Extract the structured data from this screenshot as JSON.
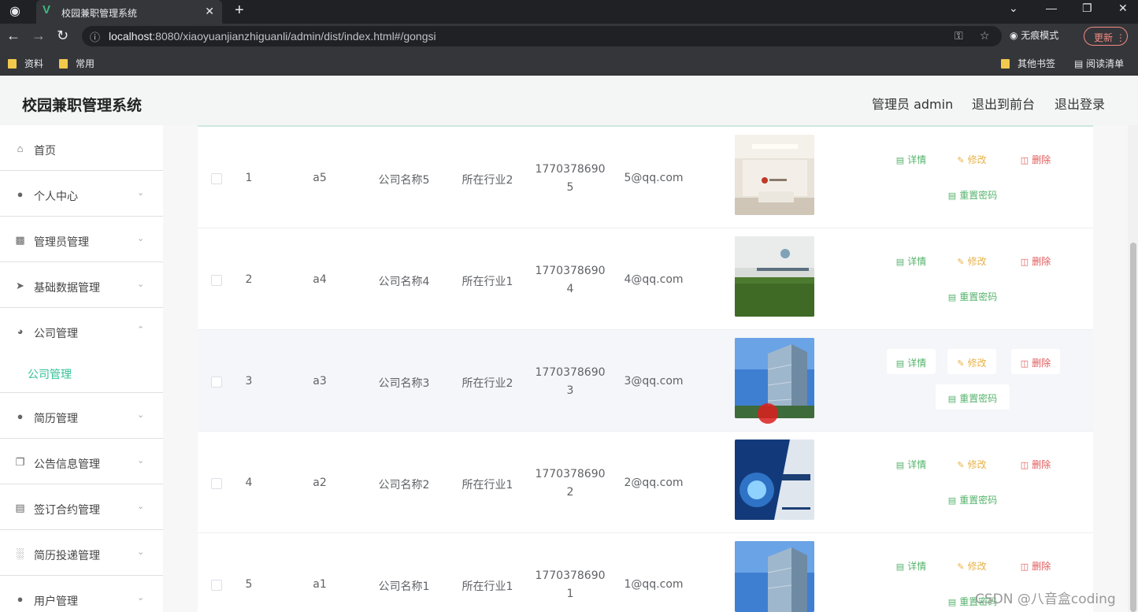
{
  "browser": {
    "tab_title": "校园兼职管理系统",
    "url_host": "localhost",
    "url_rest": ":8080/xiaoyuanjianzhiguanli/admin/dist/index.html#/gongsi",
    "incognito_label": "无痕模式",
    "update_label": "更新",
    "bookmarks": [
      "资料",
      "常用"
    ],
    "other_bookmarks": "其他书签",
    "reading_list": "阅读清单"
  },
  "header": {
    "title": "校园兼职管理系统",
    "user": "管理员 admin",
    "front": "退出到前台",
    "logout": "退出登录"
  },
  "sidebar": {
    "items": [
      {
        "label": "首页",
        "icon": "home-icon"
      },
      {
        "label": "个人中心",
        "icon": "user-icon"
      },
      {
        "label": "管理员管理",
        "icon": "chart-icon"
      },
      {
        "label": "基础数据管理",
        "icon": "send-icon"
      },
      {
        "label": "公司管理",
        "icon": "gauge-icon"
      },
      {
        "label": "简历管理",
        "icon": "user-icon"
      },
      {
        "label": "公告信息管理",
        "icon": "copy-icon"
      },
      {
        "label": "签订合约管理",
        "icon": "card-icon"
      },
      {
        "label": "简历投递管理",
        "icon": "bar-chart-icon"
      },
      {
        "label": "用户管理",
        "icon": "user-icon"
      }
    ],
    "submenu_label": "公司管理"
  },
  "table": {
    "rows": [
      {
        "index": "1",
        "account": "a5",
        "name": "公司名称5",
        "industry": "所在行业2",
        "phone1": "1770378690",
        "phone2": "5",
        "email": "5@qq.com",
        "image": "office-lobby"
      },
      {
        "index": "2",
        "account": "a4",
        "name": "公司名称4",
        "industry": "所在行业1",
        "phone1": "1770378690",
        "phone2": "4",
        "email": "4@qq.com",
        "image": "logo-wall"
      },
      {
        "index": "3",
        "account": "a3",
        "name": "公司名称3",
        "industry": "所在行业2",
        "phone1": "1770378690",
        "phone2": "3",
        "email": "3@qq.com",
        "image": "tower"
      },
      {
        "index": "4",
        "account": "a2",
        "name": "公司名称2",
        "industry": "所在行业1",
        "phone1": "1770378690",
        "phone2": "2",
        "email": "2@qq.com",
        "image": "brochure"
      },
      {
        "index": "5",
        "account": "a1",
        "name": "公司名称1",
        "industry": "所在行业1",
        "phone1": "1770378690",
        "phone2": "1",
        "email": "1@qq.com",
        "image": "tower"
      }
    ],
    "actions": {
      "detail": "详情",
      "edit": "修改",
      "delete": "删除",
      "reset": "重置密码"
    }
  },
  "watermark": "CSDN @八音盒coding"
}
